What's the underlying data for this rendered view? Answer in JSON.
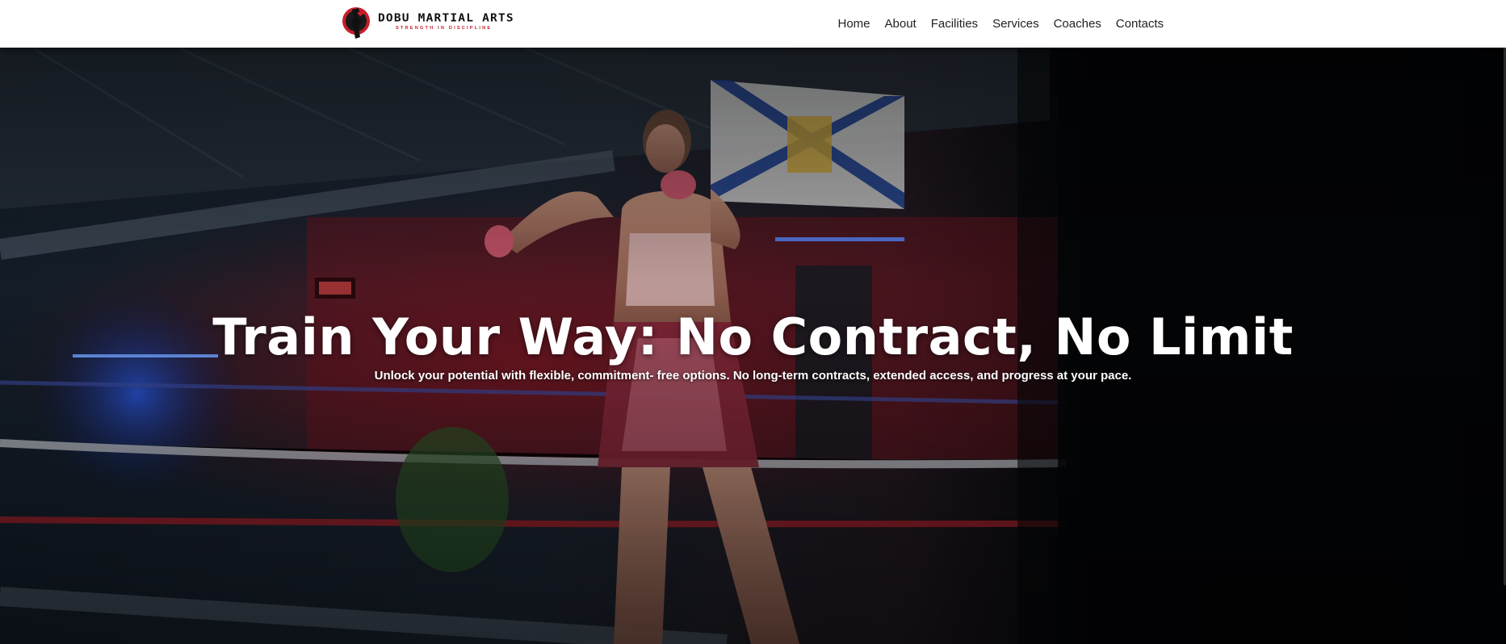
{
  "brand": {
    "name": "DOBU MARTIAL ARTS",
    "tagline": "STRENGTH IN DISCIPLINE",
    "accent_color": "#c81e2a"
  },
  "nav": {
    "items": [
      {
        "label": "Home"
      },
      {
        "label": "About"
      },
      {
        "label": "Facilities"
      },
      {
        "label": "Services"
      },
      {
        "label": "Coaches"
      },
      {
        "label": "Contacts"
      }
    ]
  },
  "hero": {
    "title": "Train Your Way: No Contract, No Limit",
    "subtitle": "Unlock your potential with flexible, commitment- free options. No long-term contracts, extended access, and progress at your pace.",
    "background_description_icon": "boxing-gym-photo"
  }
}
